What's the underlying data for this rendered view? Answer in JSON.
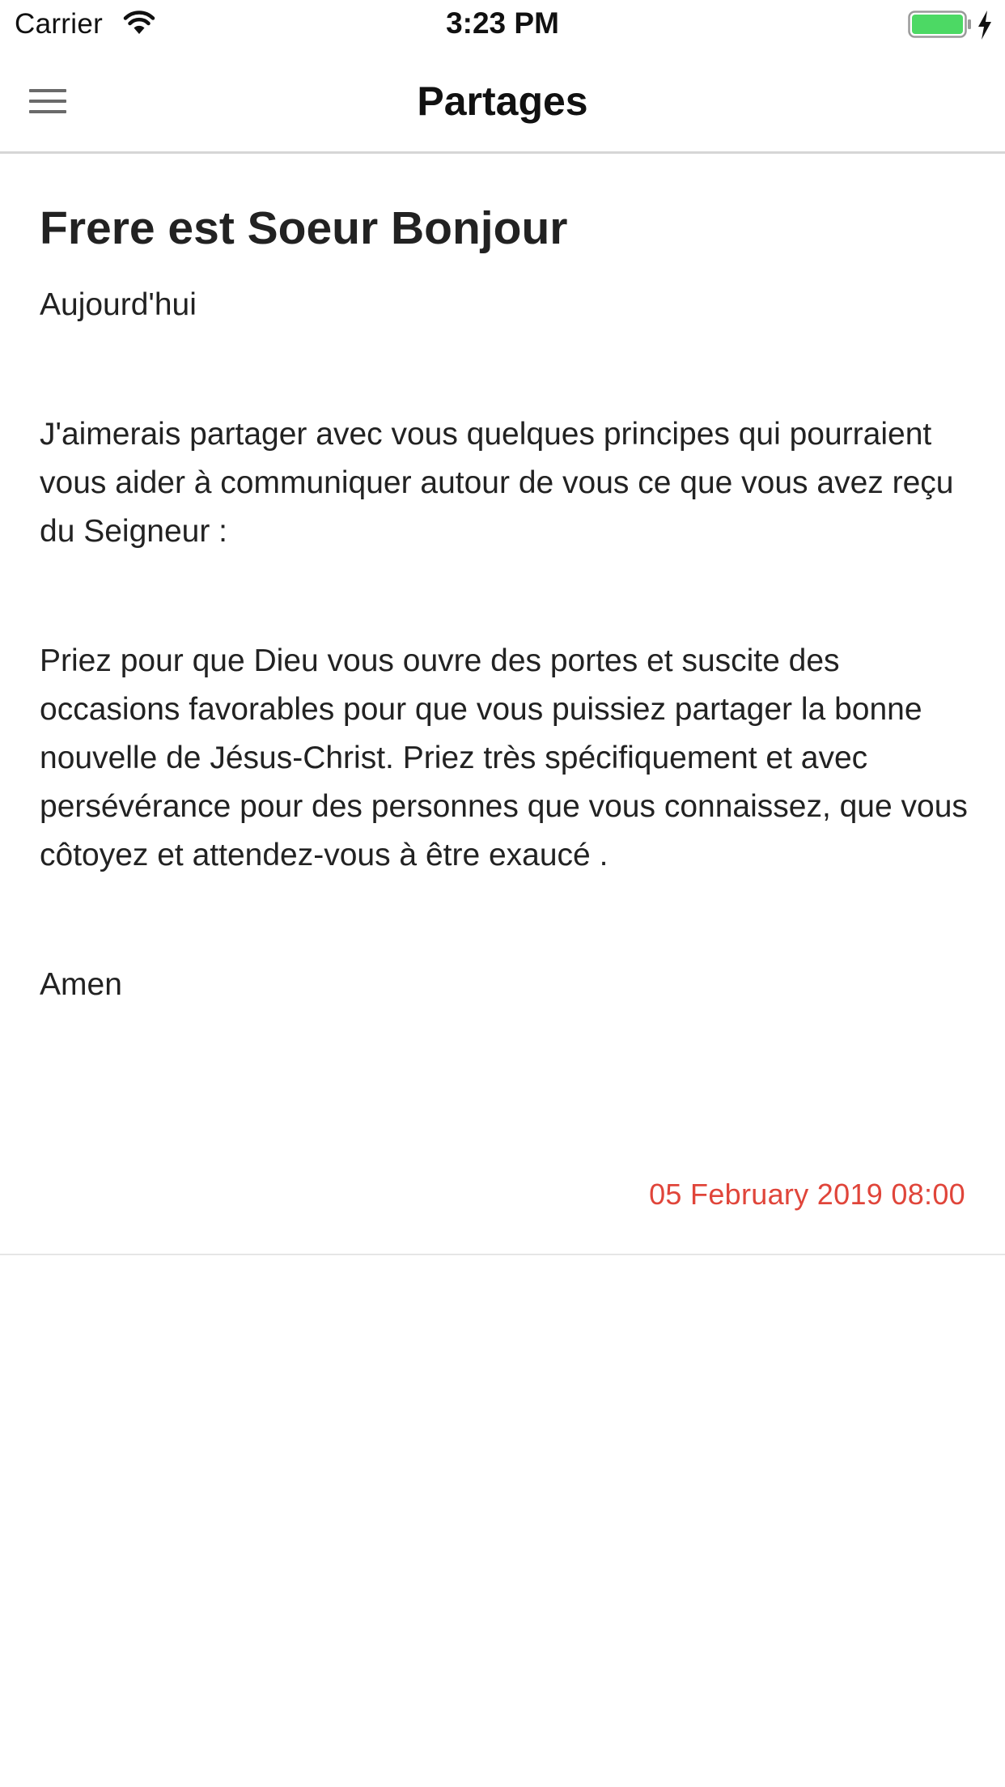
{
  "status_bar": {
    "carrier": "Carrier",
    "time": "3:23 PM",
    "battery_color": "#4cd964"
  },
  "nav": {
    "title": "Partages",
    "menu_icon": "hamburger-menu-icon"
  },
  "article": {
    "title": "Frere est Soeur Bonjour",
    "paragraphs": [
      "Aujourd'hui",
      "J'aimerais partager avec vous quelques principes qui pourraient vous aider à communiquer autour de vous ce que vous avez reçu du Seigneur :",
      "Priez pour que Dieu vous ouvre des portes et suscite des occasions favorables pour que vous puissiez partager la bonne nouvelle de Jésus-Christ. Priez très spécifiquement et avec persévérance pour des personnes que vous connaissez, que vous côtoyez et attendez-vous à être exaucé .",
      "Amen"
    ],
    "date": "05 February 2019 08:00",
    "date_color": "#e0453a"
  }
}
